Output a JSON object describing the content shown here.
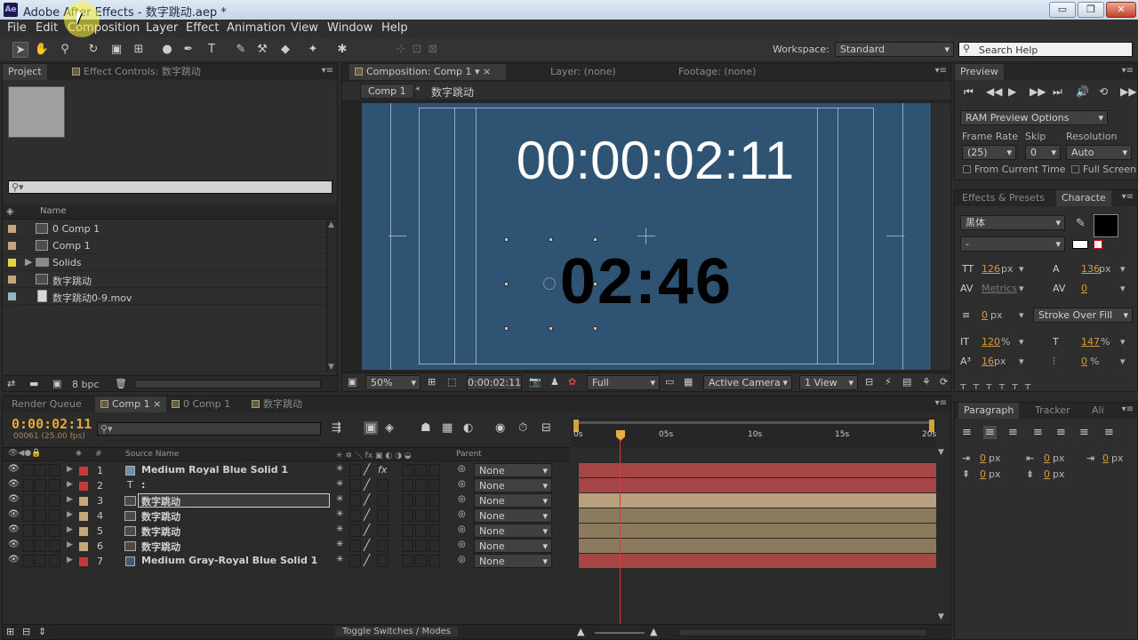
{
  "window": {
    "title": "Adobe After Effects - 数字跳动.aep *",
    "logo": "Ae",
    "buttons": {
      "minimize": "▭",
      "maximize": "❐",
      "close": "✕"
    }
  },
  "menu": [
    "File",
    "Edit",
    "Composition",
    "Layer",
    "Effect",
    "Animation",
    "View",
    "Window",
    "Help"
  ],
  "toolbar": {
    "workspace_label": "Workspace:",
    "workspace_value": "Standard",
    "search_placeholder": "Search Help"
  },
  "project_panel": {
    "tab_project": "Project",
    "tab_effect_controls": "Effect Controls: 数字跳动",
    "col_name": "Name",
    "items": [
      {
        "name": "0 Comp 1",
        "color": "#c4a67c",
        "type": "comp"
      },
      {
        "name": "Comp 1",
        "color": "#c4a67c",
        "type": "comp"
      },
      {
        "name": "Solids",
        "color": "#e6d33b",
        "type": "folder"
      },
      {
        "name": "数字跳动",
        "color": "#c4a67c",
        "type": "comp"
      },
      {
        "name": "数字跳动0-9.mov",
        "color": "#8fb7c4",
        "type": "footage"
      }
    ],
    "bpc": "8 bpc"
  },
  "composition_panel": {
    "tab_comp": "Composition: Comp 1",
    "tab_layer": "Layer: (none)",
    "tab_footage": "Footage: (none)",
    "breadcrumb": [
      "Comp 1",
      "数字跳动"
    ],
    "timecode_text": "00:00:02:11",
    "number_text": "02:46",
    "footer": {
      "zoom": "50%",
      "timecode": "0:00:02:11",
      "resolution": "Full",
      "camera": "Active Camera",
      "views": "1 View"
    }
  },
  "preview_panel": {
    "tab": "Preview",
    "ram_options": "RAM Preview Options",
    "frame_rate_label": "Frame Rate",
    "frame_rate": "(25)",
    "skip_label": "Skip",
    "skip": "0",
    "resolution_label": "Resolution",
    "resolution": "Auto",
    "from_current": "From Current Time",
    "full_screen": "Full Screen"
  },
  "character_panel": {
    "tab_effects": "Effects & Presets",
    "tab_character": "Characte",
    "font": "黑体",
    "style": "-",
    "size": "126",
    "size_unit": "px",
    "leading": "136",
    "leading_unit": "px",
    "kerning": "Metrics",
    "tracking": "0",
    "stroke_width": "0",
    "stroke_unit": "px",
    "stroke_mode": "Stroke Over Fill",
    "vscale": "120",
    "vscale_unit": "%",
    "hscale": "147",
    "hscale_unit": "%",
    "baseline": "16",
    "baseline_unit": "px",
    "tsume": "0",
    "tsume_unit": "%",
    "fill_color": "#000000",
    "stroke_color": "#000000"
  },
  "paragraph_panel": {
    "tab_paragraph": "Paragraph",
    "tab_tracker": "Tracker",
    "tab_align": "Ali",
    "indent_left": "0",
    "indent_right": "0",
    "indent_first": "0",
    "space_before": "0",
    "space_after": "0",
    "unit": "px"
  },
  "timeline": {
    "tabs": [
      "Render Queue",
      "Comp 1",
      "0 Comp 1",
      "数字跳动"
    ],
    "current_time": "0:00:02:11",
    "frame_info": "00061 (25.00 fps)",
    "col_source": "Source Name",
    "col_parent": "Parent",
    "ruler": [
      "0s",
      "05s",
      "10s",
      "15s",
      "20s"
    ],
    "toggle_label": "Toggle Switches / Modes",
    "layers": [
      {
        "num": "1",
        "name": "Medium Royal Blue Solid 1",
        "label": "#c23a3a",
        "icon": "solid",
        "parent": "None",
        "bar": "#a64646",
        "fx": true
      },
      {
        "num": "2",
        "name": ":",
        "label": "#c23a3a",
        "icon": "text",
        "parent": "None",
        "bar": "#a64646",
        "fx": false
      },
      {
        "num": "3",
        "name": "数字跳动",
        "label": "#c4a67c",
        "icon": "comp",
        "parent": "None",
        "bar": "#b8a07e",
        "fx": false,
        "selected": true
      },
      {
        "num": "4",
        "name": "数字跳动",
        "label": "#c4a67c",
        "icon": "comp",
        "parent": "None",
        "bar": "#8c7a5e",
        "fx": false
      },
      {
        "num": "5",
        "name": "数字跳动",
        "label": "#c4a67c",
        "icon": "comp",
        "parent": "None",
        "bar": "#8c7a5e",
        "fx": false
      },
      {
        "num": "6",
        "name": "数字跳动",
        "label": "#c4a67c",
        "icon": "comp",
        "parent": "None",
        "bar": "#8c7a5e",
        "fx": false
      },
      {
        "num": "7",
        "name": "Medium Gray-Royal Blue Solid 1",
        "label": "#c23a3a",
        "icon": "solid",
        "parent": "None",
        "bar": "#a64646",
        "fx": false
      }
    ]
  }
}
